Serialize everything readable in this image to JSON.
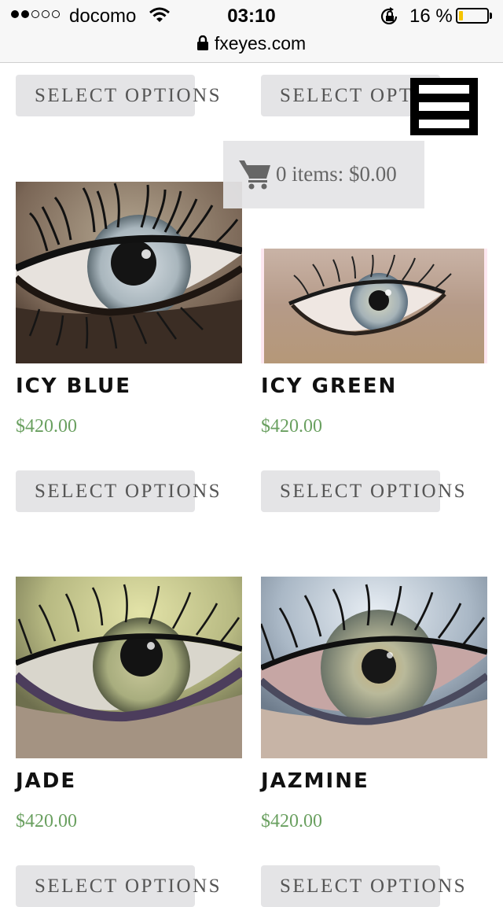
{
  "status_bar": {
    "carrier": "docomo",
    "time": "03:10",
    "battery": "16 %",
    "battery_level": 0.16
  },
  "browser": {
    "url": "fxeyes.com"
  },
  "cart": {
    "summary": "0 items: $0.00"
  },
  "products": [
    {
      "name": "",
      "price": "",
      "button": "SELECT OPTIONS"
    },
    {
      "name": "",
      "price": "",
      "button": "SELECT OPTIONS"
    },
    {
      "name": "ICY BLUE",
      "price": "$420.00",
      "button": "SELECT OPTIONS"
    },
    {
      "name": "ICY GREEN",
      "price": "$420.00",
      "button": "SELECT OPTIONS"
    },
    {
      "name": "JADE",
      "price": "$420.00",
      "button": "SELECT OPTIONS"
    },
    {
      "name": "JAZMINE",
      "price": "$420.00",
      "button": "SELECT OPTIONS"
    }
  ],
  "colors": {
    "price": "#6aa060",
    "button_bg": "#e4e4e6",
    "button_text": "#555555"
  }
}
